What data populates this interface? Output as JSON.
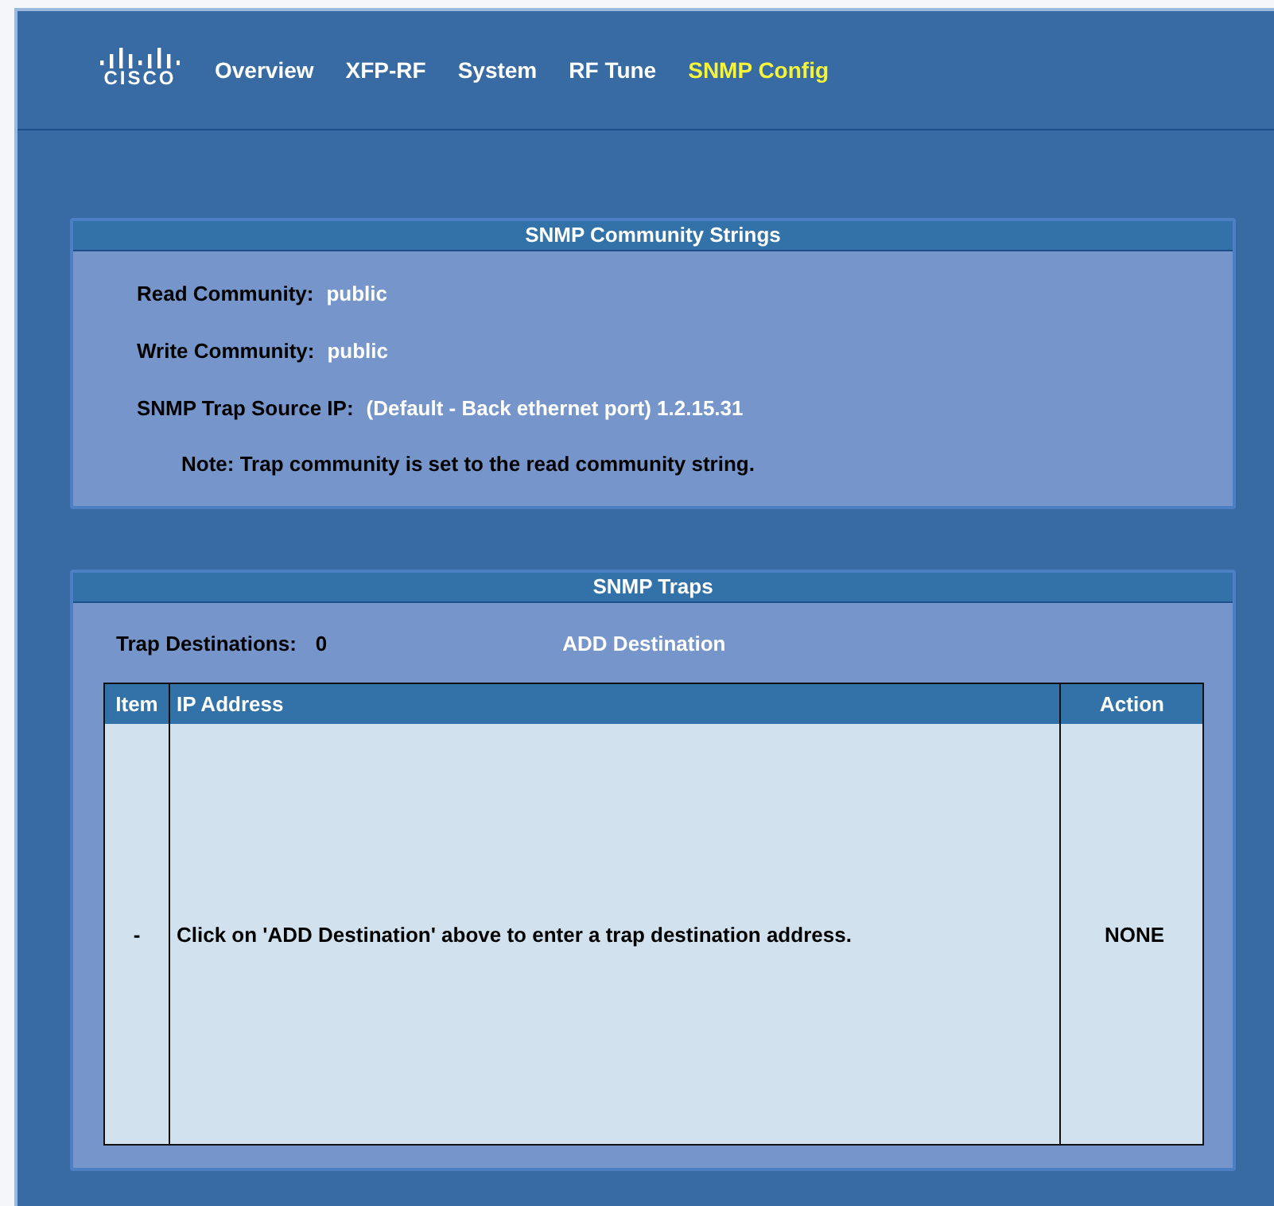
{
  "header": {
    "logo_text": "CISCO",
    "nav": [
      {
        "label": "Overview",
        "selected": false
      },
      {
        "label": "XFP-RF",
        "selected": false
      },
      {
        "label": "System",
        "selected": false
      },
      {
        "label": "RF Tune",
        "selected": false
      },
      {
        "label": "SNMP Config",
        "selected": true
      }
    ]
  },
  "community_panel": {
    "title": "SNMP Community Strings",
    "fields": [
      {
        "label": "Read Community:",
        "value": "public"
      },
      {
        "label": "Write Community:",
        "value": "public"
      },
      {
        "label": "SNMP Trap Source IP:",
        "value": "(Default - Back ethernet port) 1.2.15.31"
      }
    ],
    "note": "Note: Trap community is set to the read community string."
  },
  "traps_panel": {
    "title": "SNMP Traps",
    "destinations_label": "Trap Destinations:",
    "destinations_count": "0",
    "add_link": "ADD Destination",
    "table": {
      "columns": [
        "Item",
        "IP Address",
        "Action"
      ],
      "rows": [
        {
          "item": "-",
          "ip_address": "Click on 'ADD Destination' above to enter a trap destination address.",
          "action": "NONE"
        }
      ]
    }
  }
}
